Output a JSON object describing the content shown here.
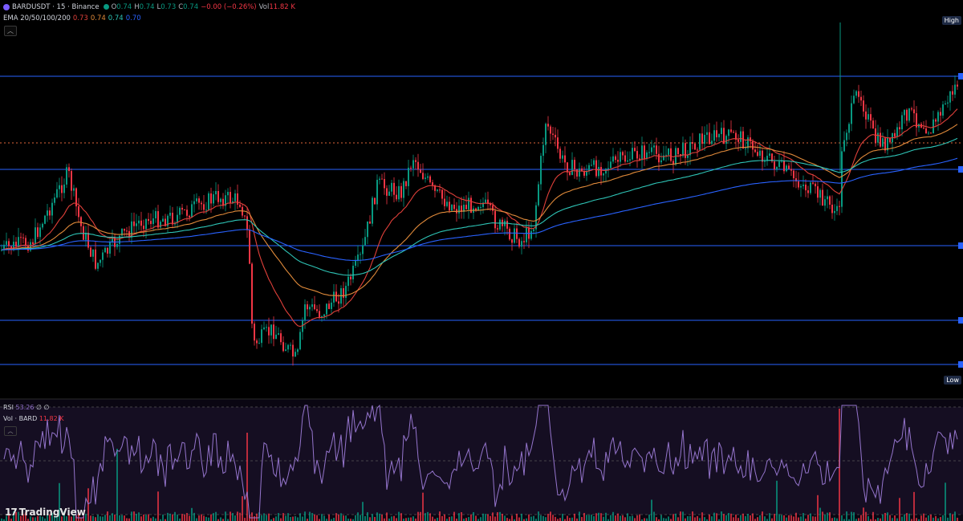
{
  "legend": {
    "symbol": "BARDUSDT · 15 · Binance",
    "open_label": "O",
    "open": "0.74",
    "high_label": "H",
    "high": "0.74",
    "low_label": "L",
    "low": "0.73",
    "close_label": "C",
    "close": "0.74",
    "change": "−0.00 (−0.26%)",
    "vol_label": "Vol",
    "vol": "11.82 K",
    "ema_label": "EMA 20/50/100/200",
    "ema20": "0.73",
    "ema50": "0.74",
    "ema100": "0.74",
    "ema200": "0.70"
  },
  "price_tags": {
    "high": "High",
    "low": "Low"
  },
  "rsi": {
    "label": "RSI",
    "value": "53.26",
    "extra": "∅ ∅"
  },
  "volume": {
    "label": "Vol · BARD",
    "value": "11.82 K"
  },
  "branding": {
    "logo_text": "TradingView"
  },
  "icons": {
    "collapse": "chevron-up-icon",
    "live": "live-dot-icon"
  },
  "colors": {
    "up": "#089981",
    "down": "#f23645",
    "ema20": "#e0403a",
    "ema50": "#e08a3a",
    "ema100": "#2ec4b6",
    "ema200": "#2962ff",
    "level_line": "#2962ff",
    "rsi_line": "#9575cd",
    "rsi_band": "#1f1530",
    "dotted": "#e0663a"
  },
  "chart_data": {
    "type": "line",
    "title": "BARDUSDT · 15 · Binance",
    "timeframe": "15",
    "series": [
      {
        "name": "EMA 20",
        "last": 0.73
      },
      {
        "name": "EMA 50",
        "last": 0.74
      },
      {
        "name": "EMA 100",
        "last": 0.74
      },
      {
        "name": "EMA 200",
        "last": 0.7
      }
    ],
    "rsi_last": 53.26,
    "volume_last": "11.82 K",
    "horizontal_levels": 5,
    "grid": false
  }
}
